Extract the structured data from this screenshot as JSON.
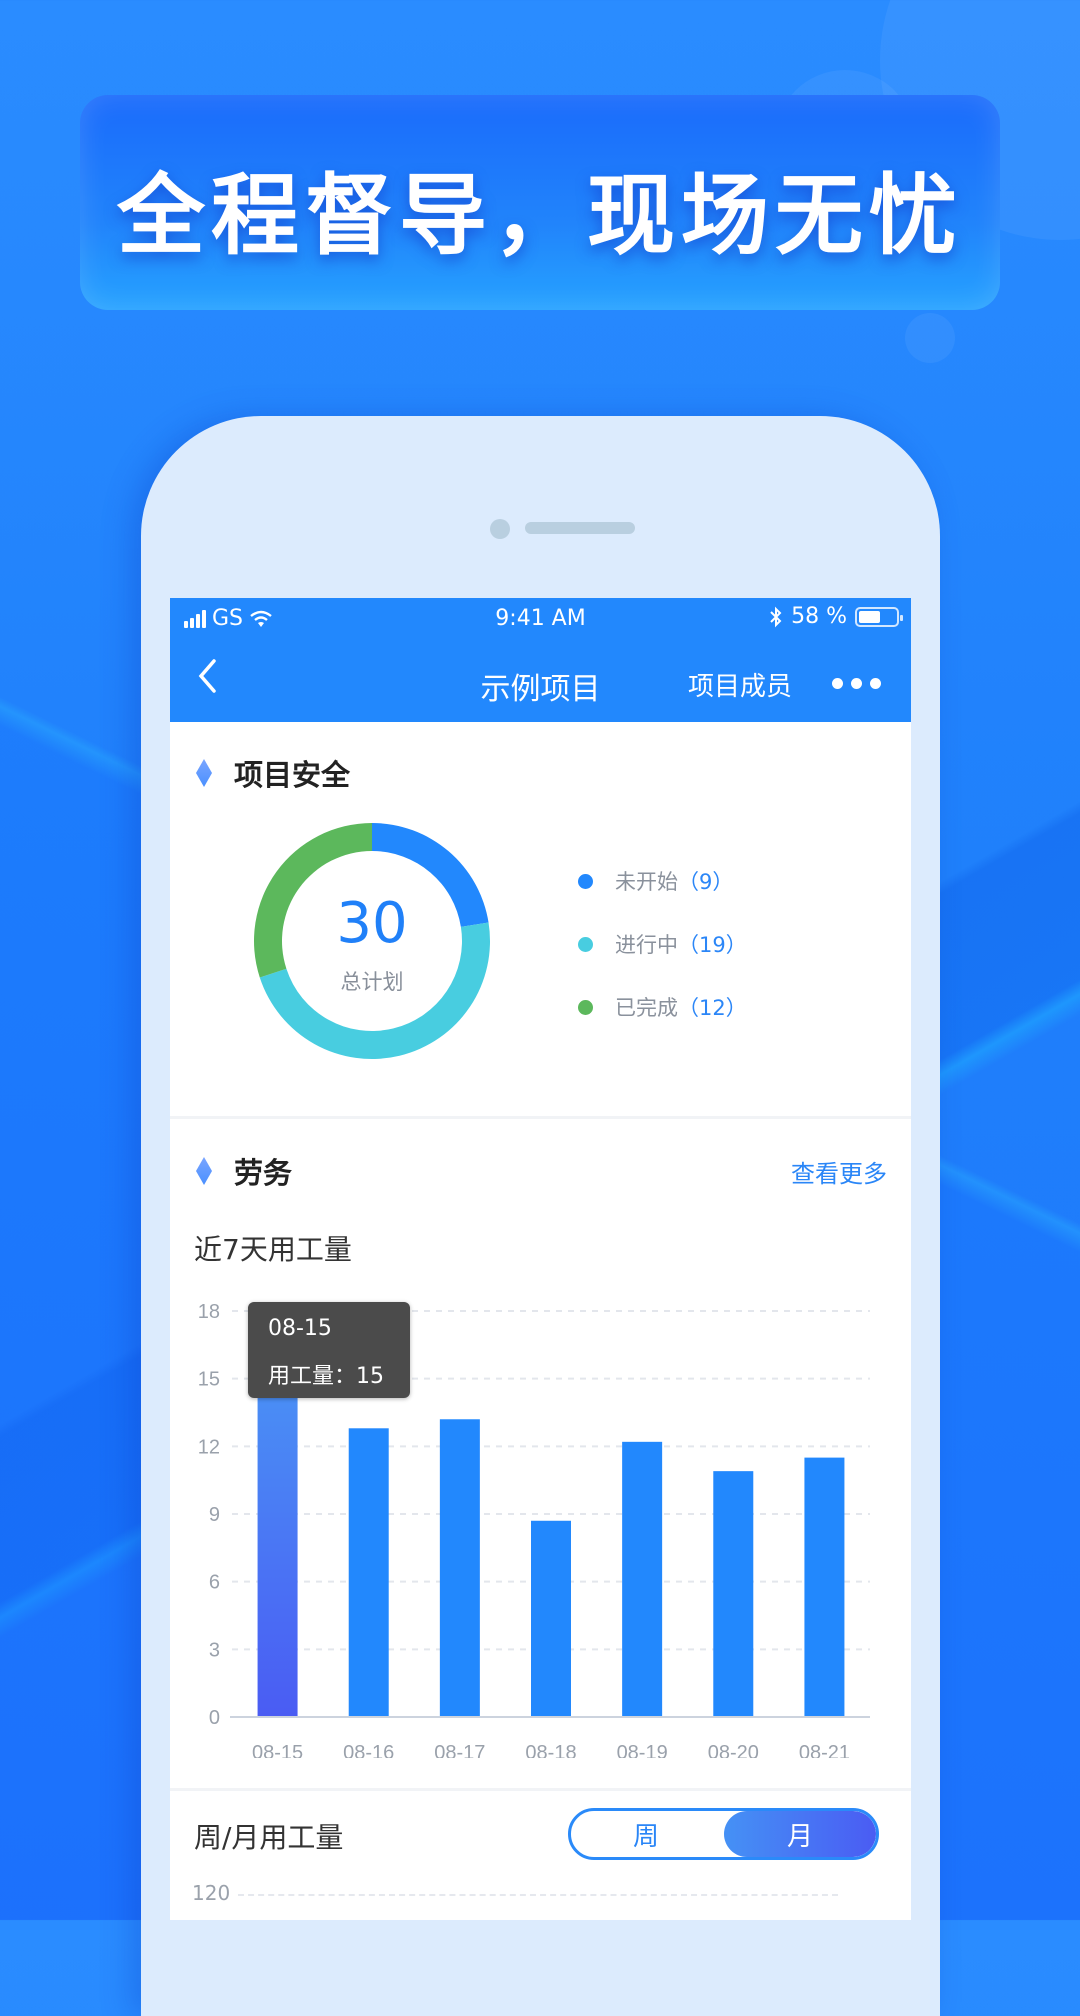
{
  "banner": {
    "title": "全程督导，现场无忧"
  },
  "status_bar": {
    "carrier": "GS",
    "time": "9:41 AM",
    "battery_percent": 58,
    "battery_label": "58 %"
  },
  "nav": {
    "back_label": "‹",
    "title": "示例项目",
    "members_label": "项目成员",
    "more_icon": "more-dots-icon"
  },
  "safety": {
    "title": "项目安全",
    "total": "30",
    "total_label": "总计划",
    "legend": [
      {
        "label": "未开始",
        "value": 9,
        "display": "（9）",
        "color": "#2288fd"
      },
      {
        "label": "进行中",
        "value": 19,
        "display": "（19）",
        "color": "#48cde0"
      },
      {
        "label": "已完成",
        "value": 12,
        "display": "（12）",
        "color": "#5cb85c"
      }
    ]
  },
  "labor": {
    "title": "劳务",
    "more_label": "查看更多",
    "recent_title": "近7天用工量",
    "tooltip": {
      "date": "08-15",
      "text": "用工量：15"
    },
    "period_title": "周/月用工量",
    "toggle": {
      "week": "周",
      "month": "月",
      "selected": "month"
    },
    "period_axis_top": "120"
  },
  "chart_data": {
    "type": "bar",
    "title": "近7天用工量",
    "categories": [
      "08-15",
      "08-16",
      "08-17",
      "08-18",
      "08-19",
      "08-20",
      "08-21"
    ],
    "values": [
      15,
      12.8,
      13.2,
      8.7,
      12.2,
      10.9,
      11.5
    ],
    "yticks": [
      0,
      3,
      6,
      9,
      12,
      15,
      18
    ],
    "ylim": [
      0,
      18
    ],
    "xlabel": "",
    "ylabel": "",
    "grid": true,
    "highlight_index": 0,
    "colors": {
      "bar": "#2288fd",
      "highlight_top": "#4a90f5",
      "highlight_bottom": "#4a5cf3",
      "grid": "#e3e6ec",
      "axis": "#ccd3de",
      "tick": "#9aa1ab"
    }
  }
}
